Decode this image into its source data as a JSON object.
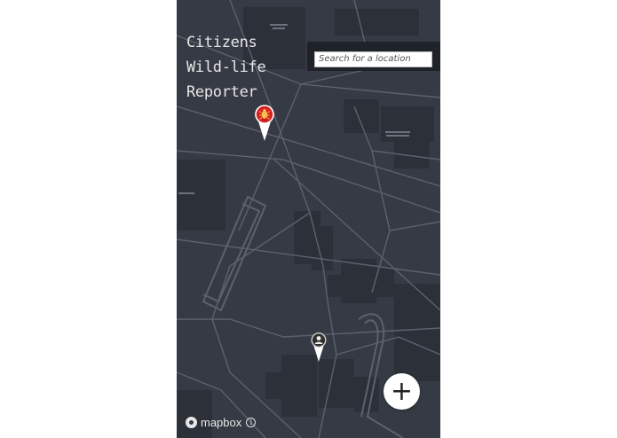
{
  "app": {
    "title_lines": [
      "Citizens",
      "Wild-life",
      "Reporter"
    ]
  },
  "search": {
    "placeholder": "Search for a location",
    "value": ""
  },
  "map": {
    "provider": "mapbox",
    "style": "dark",
    "background_color": "#353a44",
    "road_color": "#5a606b",
    "building_color": "#2b2f37"
  },
  "markers": [
    {
      "type": "wildlife-report",
      "icon": "bug-icon",
      "pin_color": "#d42020"
    },
    {
      "type": "user-location",
      "icon": "person-icon",
      "pin_color": "#2f2f2f"
    }
  ],
  "add_button": {
    "label": "+",
    "icon": "plus-icon"
  },
  "attribution": {
    "text": "mapbox",
    "info_icon": "info-icon"
  }
}
